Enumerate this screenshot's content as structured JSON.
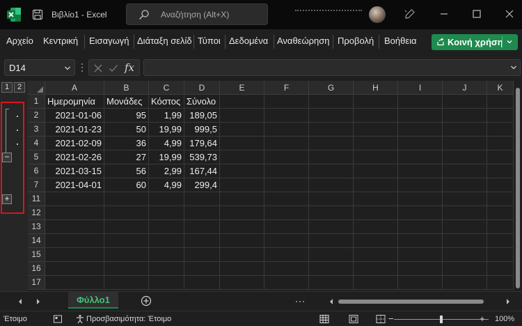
{
  "window": {
    "app_title": "Βιβλίο1  -  Excel",
    "search_placeholder": "Αναζήτηση (Alt+X)"
  },
  "ribbon": {
    "tabs": [
      "Αρχείο",
      "Κεντρική",
      "Εισαγωγή",
      "Διάταξη σελίδας",
      "Τύποι",
      "Δεδομένα",
      "Αναθεώρηση",
      "Προβολή",
      "Βοήθεια"
    ],
    "share_label": "Κοινή χρήση",
    "accent_color": "#1e8a4f"
  },
  "formula_bar": {
    "name_box": "D14",
    "fx_label": "fx",
    "formula": ""
  },
  "outline": {
    "levels": [
      "1",
      "2"
    ],
    "collapse_symbol": "−",
    "expand_symbol": "+"
  },
  "sheet": {
    "columns": [
      "A",
      "B",
      "C",
      "D",
      "E",
      "F",
      "G",
      "H",
      "I",
      "J",
      "K"
    ],
    "rows": [
      {
        "num": "1",
        "cells": [
          "Ημερομηνία",
          "Μονάδες",
          "Κόστος",
          "Σύνολο"
        ]
      },
      {
        "num": "2",
        "cells": [
          "2021-01-06",
          "95",
          "1,99",
          "189,05"
        ]
      },
      {
        "num": "3",
        "cells": [
          "2021-01-23",
          "50",
          "19,99",
          "999,5"
        ]
      },
      {
        "num": "4",
        "cells": [
          "2021-02-09",
          "36",
          "4,99",
          "179,64"
        ]
      },
      {
        "num": "5",
        "cells": [
          "2021-02-26",
          "27",
          "19,99",
          "539,73"
        ]
      },
      {
        "num": "6",
        "cells": [
          "2021-03-15",
          "56",
          "2,99",
          "167,44"
        ]
      },
      {
        "num": "7",
        "cells": [
          "2021-04-01",
          "60",
          "4,99",
          "299,4"
        ]
      },
      {
        "num": "11",
        "cells": [
          "",
          "",
          "",
          ""
        ]
      },
      {
        "num": "12",
        "cells": [
          "",
          "",
          "",
          ""
        ]
      },
      {
        "num": "13",
        "cells": [
          "",
          "",
          "",
          ""
        ]
      },
      {
        "num": "14",
        "cells": [
          "",
          "",
          "",
          ""
        ]
      },
      {
        "num": "15",
        "cells": [
          "",
          "",
          "",
          ""
        ]
      },
      {
        "num": "16",
        "cells": [
          "",
          "",
          "",
          ""
        ]
      },
      {
        "num": "17",
        "cells": [
          "",
          "",
          "",
          ""
        ]
      }
    ]
  },
  "sheet_tabs": {
    "active": "Φύλλο1"
  },
  "status": {
    "ready": "Έτοιμο",
    "accessibility": "Προσβασιμότητα: Έτοιμο",
    "zoom": "100%"
  }
}
